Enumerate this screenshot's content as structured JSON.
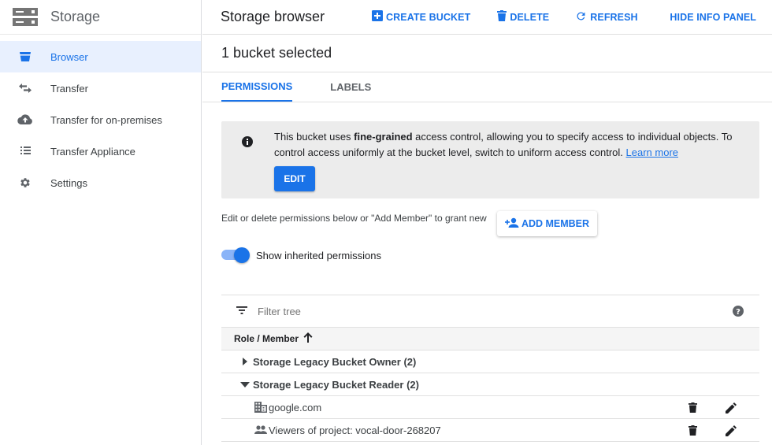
{
  "app": {
    "title": "Storage"
  },
  "sidebar": {
    "items": [
      {
        "label": "Browser",
        "icon": "bucket-icon",
        "active": true
      },
      {
        "label": "Transfer",
        "icon": "swap-arrows-icon"
      },
      {
        "label": "Transfer for on-premises",
        "icon": "cloud-upload-icon"
      },
      {
        "label": "Transfer Appliance",
        "icon": "list-icon"
      },
      {
        "label": "Settings",
        "icon": "gear-icon"
      }
    ]
  },
  "toolbar": {
    "title": "Storage browser",
    "create_label": "CREATE BUCKET",
    "delete_label": "DELETE",
    "refresh_label": "REFRESH",
    "hide_panel_label": "HIDE INFO PANEL"
  },
  "panel": {
    "selection_title": "1 bucket selected",
    "tabs": [
      {
        "label": "PERMISSIONS",
        "active": true
      },
      {
        "label": "LABELS"
      }
    ],
    "notice": {
      "text_before": "This bucket uses ",
      "text_bold": "fine-grained",
      "text_after": " access control, allowing you to specify access to individual objects. To control access uniformly at the bucket level, switch to uniform access control. ",
      "link": "Learn more",
      "edit_label": "EDIT"
    },
    "permissions_hint": "Edit or delete permissions below or \"Add Member\" to grant new",
    "add_member_label": "ADD MEMBER",
    "show_inherited_label": "Show inherited permissions",
    "show_inherited": true,
    "filter_placeholder": "Filter tree",
    "column_header": "Role / Member",
    "sort": "ascending",
    "groups": [
      {
        "label": "Storage Legacy Bucket Owner (2)",
        "expanded": false
      },
      {
        "label": "Storage Legacy Bucket Reader (2)",
        "expanded": true
      }
    ],
    "members": [
      {
        "label": "google.com",
        "icon": "domain-icon"
      },
      {
        "label": "Viewers of project: vocal-door-268207",
        "icon": "people-icon"
      }
    ]
  },
  "colors": {
    "accent": "#1a73e8",
    "active_bg": "#e8f0fe",
    "notice_bg": "#ececec"
  }
}
